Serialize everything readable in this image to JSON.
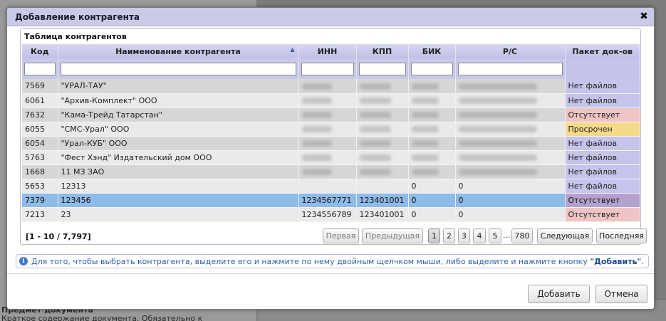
{
  "background": {
    "heading": "Предмет документа",
    "subtext": "Краткое содержание документа. Обязательно к заполнению)"
  },
  "dialog": {
    "title": "Добавление контрагента",
    "close_icon": "close-icon",
    "grid": {
      "caption": "Таблица контрагентов",
      "columns": [
        "Код",
        "Наименование контрагента",
        "ИНН",
        "КПП",
        "БИК",
        "Р/С",
        "Пакет док-ов"
      ],
      "sort": {
        "column": "Наименование контрагента",
        "direction": "asc",
        "icon": "sort-ascending-icon"
      },
      "filters": [
        "",
        "",
        "",
        "",
        "",
        ""
      ],
      "rows": [
        {
          "code": "7569",
          "name": "\"УРАЛ-ТАУ\"",
          "inn": "",
          "kpp": "",
          "bik": "",
          "rs": "",
          "status": "Нет файлов",
          "status_kind": "none",
          "blurred": true
        },
        {
          "code": "6061",
          "name": "\"Архив-Комплект\" ООО",
          "inn": "",
          "kpp": "",
          "bik": "",
          "rs": "",
          "status": "Нет файлов",
          "status_kind": "none",
          "blurred": true
        },
        {
          "code": "7632",
          "name": "\"Кама-Трейд Татарстан\"",
          "inn": "",
          "kpp": "",
          "bik": "",
          "rs": "",
          "status": "Отсутствует",
          "status_kind": "absent",
          "blurred": true
        },
        {
          "code": "6055",
          "name": "\"СМС-Урал\" ООО",
          "inn": "",
          "kpp": "",
          "bik": "",
          "rs": "",
          "status": "Просрочен",
          "status_kind": "late",
          "blurred": true
        },
        {
          "code": "6054",
          "name": "\"Урал-КУБ\" ООО",
          "inn": "",
          "kpp": "",
          "bik": "",
          "rs": "",
          "status": "Нет файлов",
          "status_kind": "none",
          "blurred": true
        },
        {
          "code": "5763",
          "name": "\"Фест Хэнд\" Издательский дом ООО",
          "inn": "",
          "kpp": "",
          "bik": "",
          "rs": "",
          "status": "Нет файлов",
          "status_kind": "none",
          "blurred": true
        },
        {
          "code": "1668",
          "name": "11 МЗ ЗАО",
          "inn": "",
          "kpp": "",
          "bik": "",
          "rs": "",
          "status": "Нет файлов",
          "status_kind": "none",
          "blurred": true
        },
        {
          "code": "5653",
          "name": "12313",
          "inn": "",
          "kpp": "",
          "bik": "0",
          "rs": "0",
          "status": "Нет файлов",
          "status_kind": "none",
          "blurred": false
        },
        {
          "code": "7379",
          "name": "123456",
          "inn": "1234567771",
          "kpp": "123401001",
          "bik": "0",
          "rs": "0",
          "status": "Отсутствует",
          "status_kind": "absent",
          "blurred": false,
          "selected": true
        },
        {
          "code": "7213",
          "name": "23",
          "inn": "1234556789",
          "kpp": "123401001",
          "bik": "0",
          "rs": "0",
          "status": "Отсутствует",
          "status_kind": "absent",
          "blurred": false
        }
      ],
      "status_colors": {
        "none": "#c4c4ec",
        "absent": "#efc4c4",
        "late": "#f4da8a",
        "selected": "#8fbbe8"
      }
    },
    "pager": {
      "info": "[1 - 10 / 7,797]",
      "first": "Первая",
      "prev": "Предыдущая",
      "pages": [
        "1",
        "2",
        "3",
        "4",
        "5"
      ],
      "current_page": "1",
      "ellipsis": "...",
      "last_page": "780",
      "next": "Следующая",
      "last": "Последняя"
    },
    "hint": {
      "icon": "info-icon",
      "text": "Для того, чтобы выбрать контрагента, выделите его и нажмите по нему двойным щелчком мыши, либо выделите и нажмите кнопку ",
      "button_ref": "\"Добавить\"",
      "end": "."
    },
    "buttons": {
      "add": "Добавить",
      "cancel": "Отмена"
    }
  }
}
